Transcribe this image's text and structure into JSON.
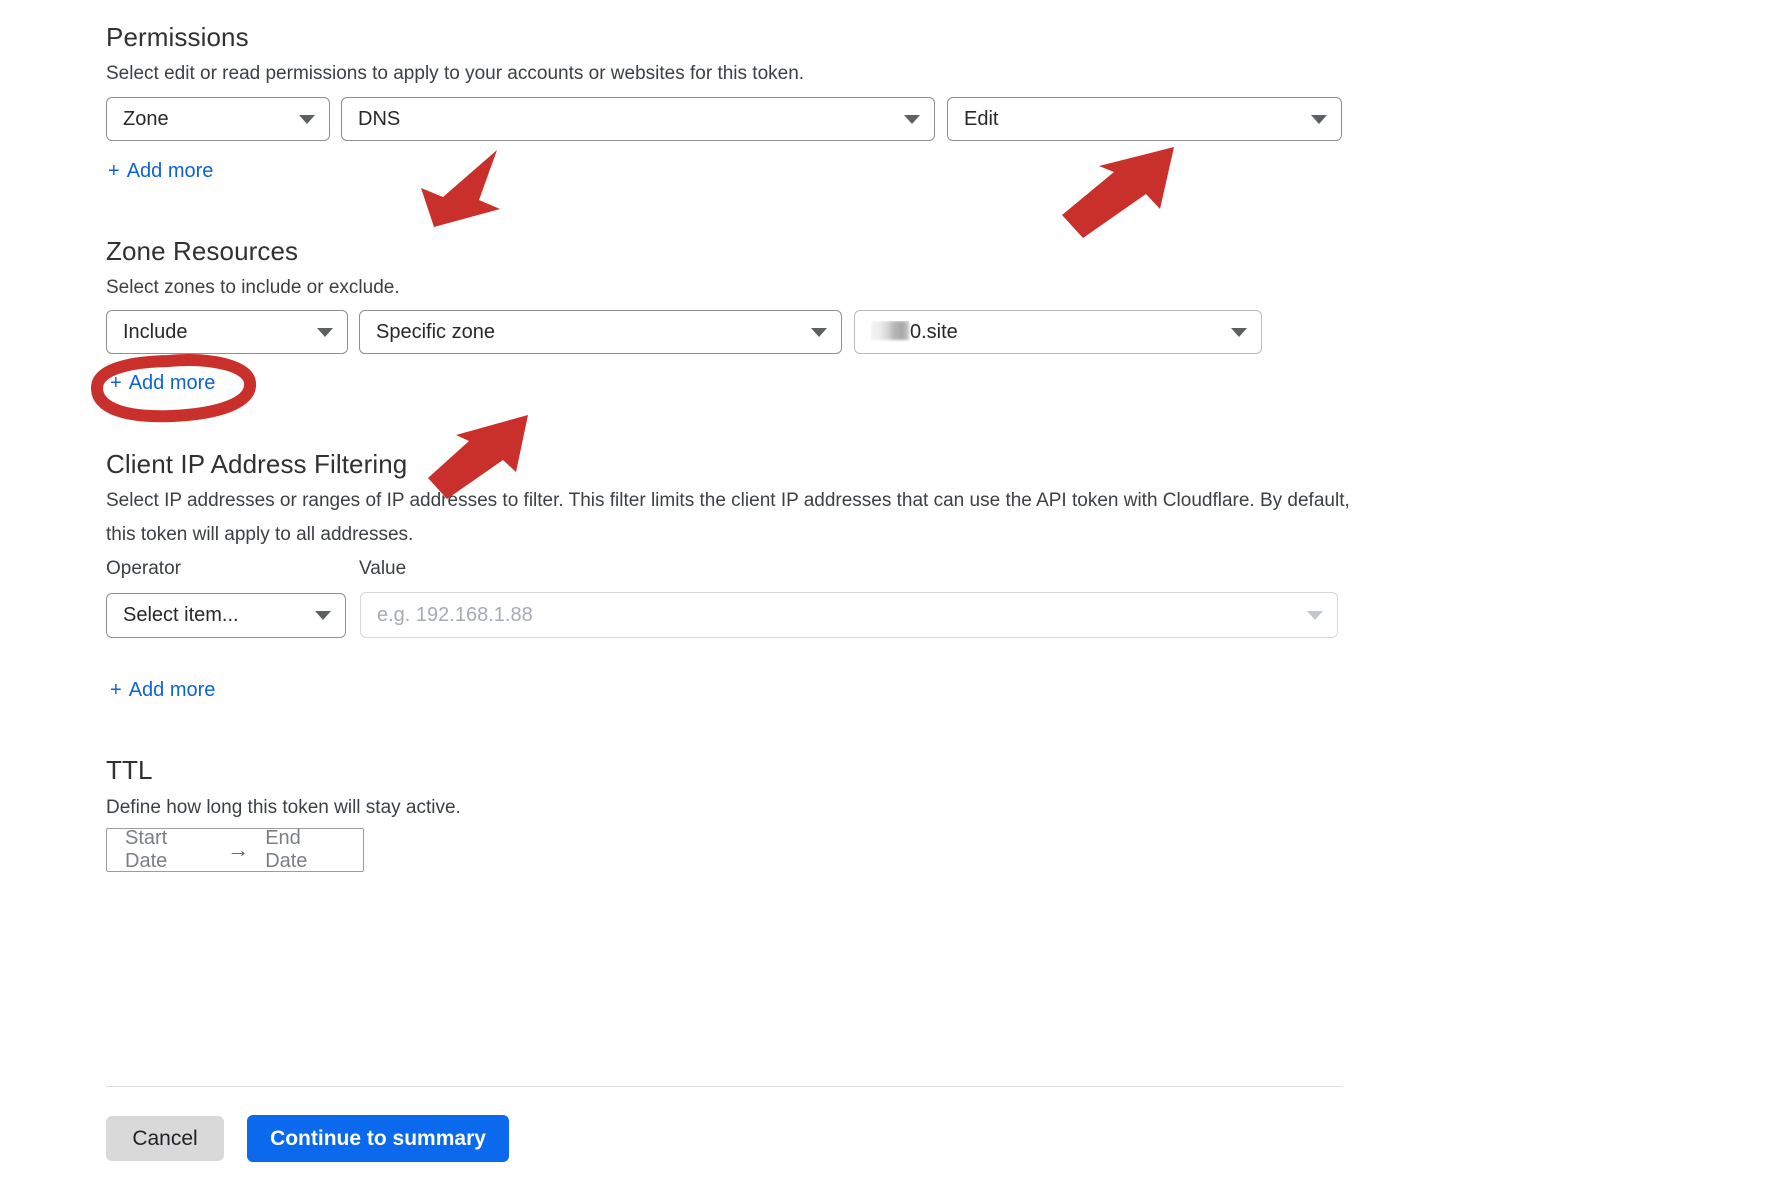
{
  "accent": {
    "link_blue": "#0d63d6",
    "primary_button_blue": "#0b69ee",
    "annotation_red": "#c9302c",
    "text_dark": "#36393a",
    "placeholder_gray": "#a7acb1"
  },
  "permissions": {
    "title": "Permissions",
    "description": "Select edit or read permissions to apply to your accounts or websites for this token.",
    "resource_select": {
      "value": "Zone",
      "icon": "chevron-down-icon"
    },
    "group_select": {
      "value": "DNS",
      "icon": "chevron-down-icon"
    },
    "access_select": {
      "value": "Edit",
      "icon": "chevron-down-icon"
    },
    "add_more_label": "Add more",
    "add_more_plus": "+"
  },
  "zone_resources": {
    "title": "Zone Resources",
    "description": "Select zones to include or exclude.",
    "scope_select": {
      "value": "Include",
      "icon": "chevron-down-icon"
    },
    "type_select": {
      "value": "Specific zone",
      "icon": "chevron-down-icon"
    },
    "zone_select": {
      "value_redacted_prefix": "",
      "value": "0.site",
      "icon": "chevron-down-icon"
    },
    "add_more_label": "Add more",
    "add_more_plus": "+"
  },
  "client_ip_filtering": {
    "title": "Client IP Address Filtering",
    "description": "Select IP addresses or ranges of IP addresses to filter. This filter limits the client IP addresses that can use the API token with Cloudflare. By default, this token will apply to all addresses.",
    "operator_label": "Operator",
    "value_label": "Value",
    "operator_select": {
      "value": "Select item...",
      "icon": "chevron-down-icon"
    },
    "value_input": {
      "value": "",
      "placeholder": "e.g. 192.168.1.88",
      "icon": "chevron-down-icon",
      "disabled": true
    },
    "add_more_label": "Add more",
    "add_more_plus": "+"
  },
  "ttl": {
    "title": "TTL",
    "description": "Define how long this token will stay active.",
    "start_date_placeholder": "Start Date",
    "end_date_placeholder": "End Date",
    "range_arrow": "→"
  },
  "footer": {
    "cancel_label": "Cancel",
    "continue_label": "Continue to summary"
  },
  "annotations": {
    "arrow_dns": "red-arrow-pointing-to-dns-select",
    "arrow_edit": "red-arrow-pointing-to-edit-select",
    "arrow_specific_zone": "red-arrow-pointing-to-specific-zone-select",
    "ellipse_add_more": "red-ellipse-highlighting-zone-resources-add-more"
  }
}
